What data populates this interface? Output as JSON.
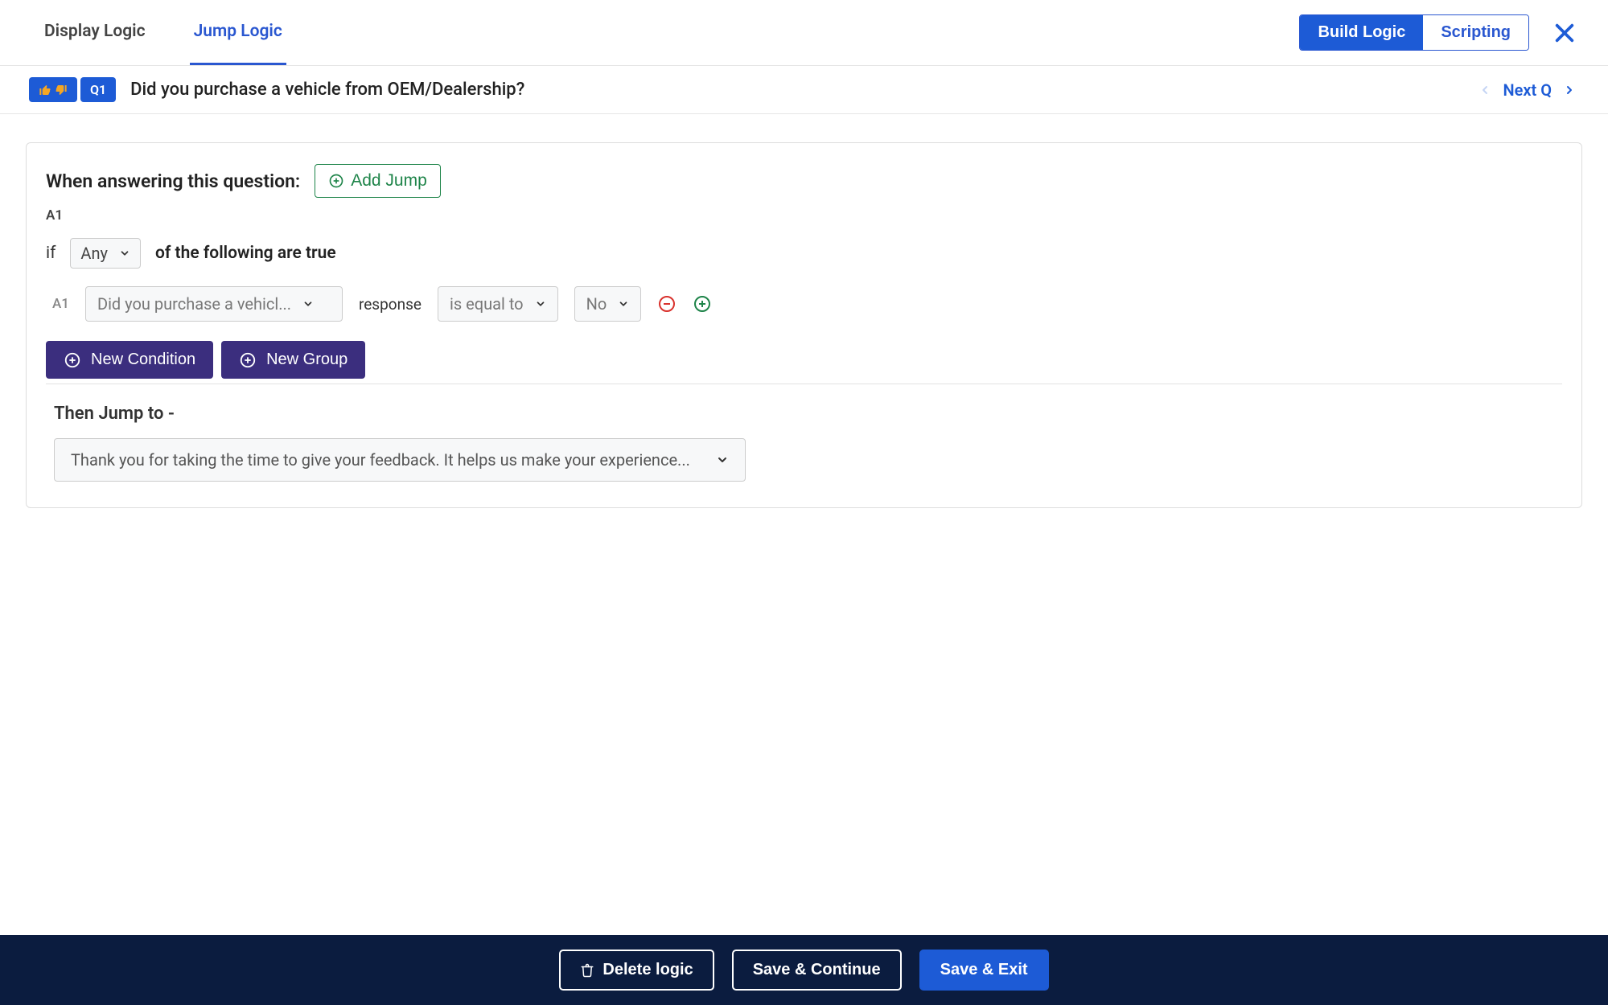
{
  "tabs": {
    "display_logic": "Display Logic",
    "jump_logic": "Jump Logic"
  },
  "top_toggle": {
    "build_logic": "Build Logic",
    "scripting": "Scripting"
  },
  "question": {
    "id": "Q1",
    "text": "Did you purchase a vehicle from OEM/Dealership?",
    "next_label": "Next Q"
  },
  "logic": {
    "when_label": "When answering this question:",
    "add_jump_label": "Add Jump",
    "group_id": "A1",
    "if_label": "if",
    "any_label": "Any",
    "of_following_label": "of the following are true",
    "rule": {
      "idx": "A1",
      "question": "Did you purchase a vehicl...",
      "response_label": "response",
      "operator": "is equal to",
      "value": "No"
    },
    "new_condition_label": "New Condition",
    "new_group_label": "New Group",
    "then_label": "Then Jump to -",
    "jump_target": "Thank you for taking the time to give your feedback. It helps us make your experience..."
  },
  "footer": {
    "delete_label": "Delete logic",
    "save_continue_label": "Save & Continue",
    "save_exit_label": "Save & Exit"
  }
}
